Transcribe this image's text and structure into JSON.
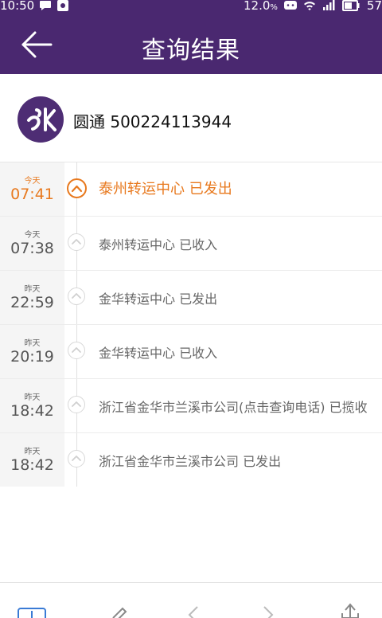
{
  "status_bar": {
    "time": "10:50",
    "right_text": "12.0",
    "right_unit": "%",
    "battery": "57"
  },
  "header": {
    "title": "查询结果",
    "back_icon": "arrow-left-icon"
  },
  "carrier": {
    "name_and_number": "圆通 500224113944",
    "logo_icon": "yto-logo"
  },
  "timeline": [
    {
      "day": "今天",
      "time": "07:41",
      "desc": "泰州转运中心 已发出",
      "active": true
    },
    {
      "day": "今天",
      "time": "07:38",
      "desc": "泰州转运中心 已收入",
      "active": false
    },
    {
      "day": "昨天",
      "time": "22:59",
      "desc": "金华转运中心 已发出",
      "active": false
    },
    {
      "day": "昨天",
      "time": "20:19",
      "desc": "金华转运中心 已收入",
      "active": false
    },
    {
      "day": "昨天",
      "time": "18:42",
      "desc": "浙江省金华市兰溪市公司(点击查询电话) 已揽收",
      "active": false
    },
    {
      "day": "昨天",
      "time": "18:42",
      "desc": "浙江省金华市兰溪市公司 已发出",
      "active": false
    }
  ],
  "colors": {
    "header_bg": "#4a2870",
    "active": "#e8791e"
  },
  "bottom_bar_icons": [
    "add-icon",
    "edit-icon",
    "prev-icon",
    "next-icon",
    "share-icon"
  ]
}
